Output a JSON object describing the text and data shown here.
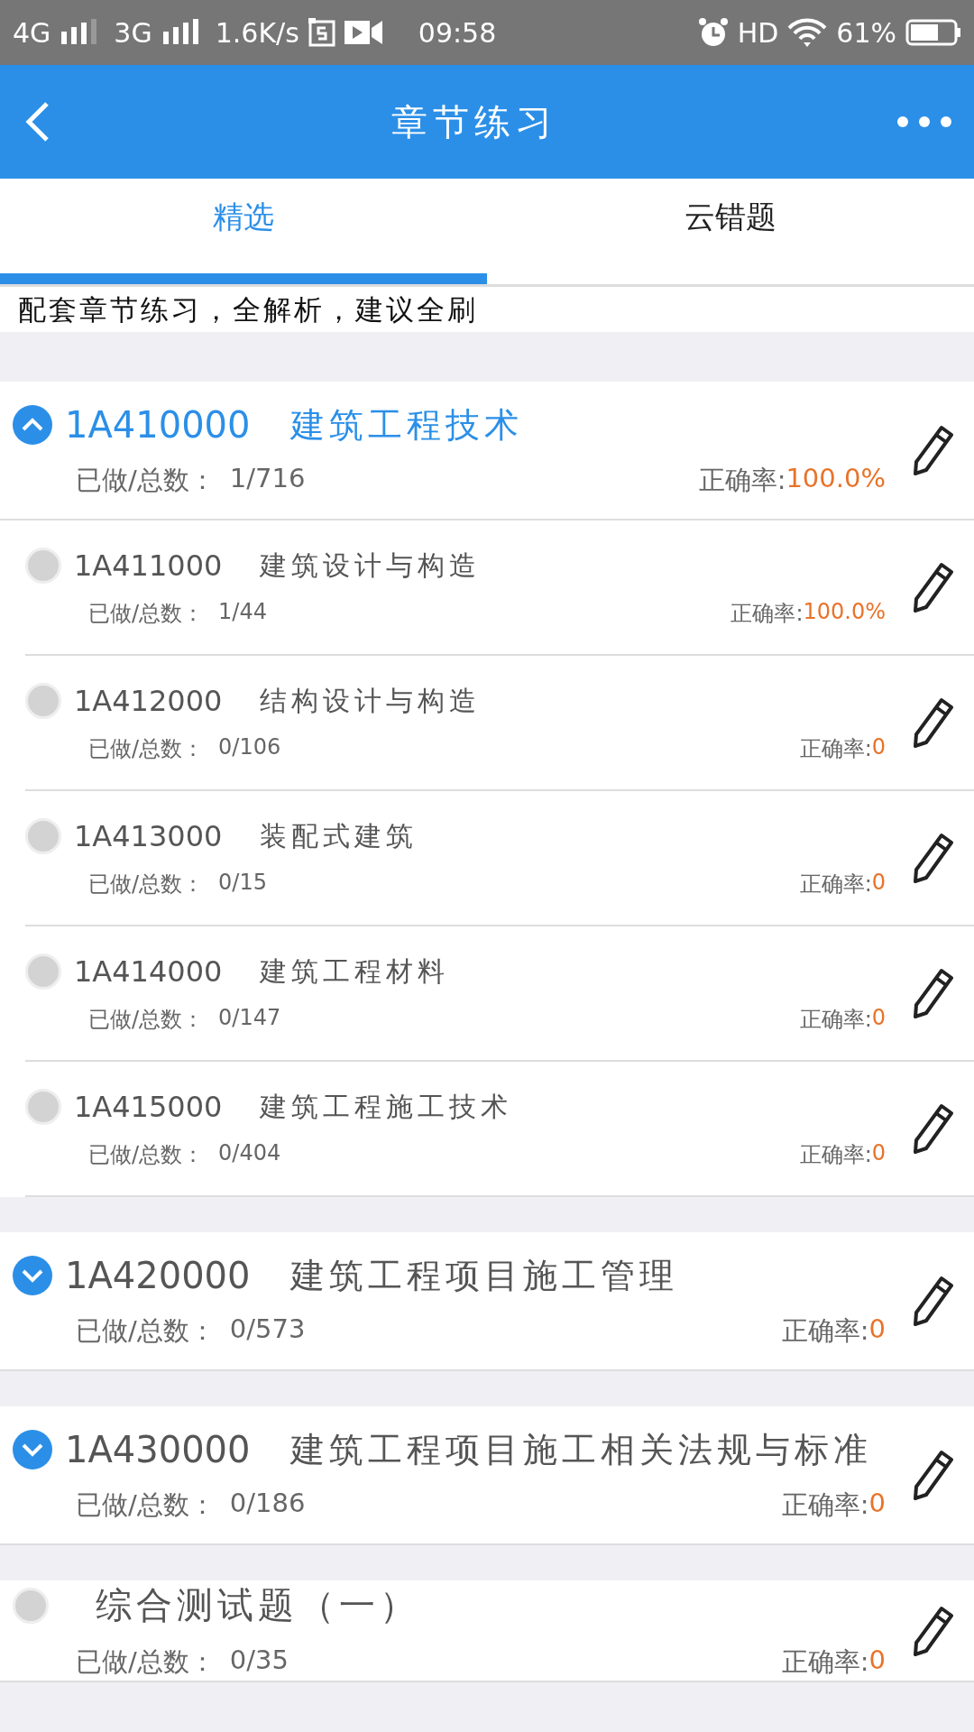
{
  "status_bar": {
    "network_1": "4G",
    "network_2": "3G",
    "speed": "1.6K/s",
    "time": "09:58",
    "hd": "HD",
    "battery": "61%"
  },
  "header": {
    "title": "章节练习"
  },
  "tabs": [
    {
      "label": "精选",
      "selected": true
    },
    {
      "label": "云错题",
      "selected": false
    }
  ],
  "description": "配套章节练习，全解析，建议全刷",
  "groups": [
    {
      "kind": "chapter",
      "code": "1A410000",
      "title": "建筑工程技术",
      "expanded": true,
      "done_label": "已做/总数：",
      "done": "1/716",
      "accuracy_label": "正确率:",
      "accuracy": "100.0%",
      "children": [
        {
          "selected": false,
          "code": "1A411000",
          "title": "建筑设计与构造",
          "done_label": "已做/总数：",
          "done": "1/44",
          "accuracy_label": "正确率:",
          "accuracy": "100.0%"
        },
        {
          "selected": false,
          "code": "1A412000",
          "title": "结构设计与构造",
          "done_label": "已做/总数：",
          "done": "0/106",
          "accuracy_label": "正确率:",
          "accuracy": "0"
        },
        {
          "selected": false,
          "code": "1A413000",
          "title": "装配式建筑",
          "done_label": "已做/总数：",
          "done": "0/15",
          "accuracy_label": "正确率:",
          "accuracy": "0"
        },
        {
          "selected": false,
          "code": "1A414000",
          "title": "建筑工程材料",
          "done_label": "已做/总数：",
          "done": "0/147",
          "accuracy_label": "正确率:",
          "accuracy": "0"
        },
        {
          "selected": false,
          "code": "1A415000",
          "title": "建筑工程施工技术",
          "done_label": "已做/总数：",
          "done": "0/404",
          "accuracy_label": "正确率:",
          "accuracy": "0"
        }
      ]
    },
    {
      "kind": "chapter",
      "code": "1A420000",
      "title": "建筑工程项目施工管理",
      "expanded": false,
      "done_label": "已做/总数：",
      "done": "0/573",
      "accuracy_label": "正确率:",
      "accuracy": "0"
    },
    {
      "kind": "chapter",
      "code": "1A430000",
      "title": "建筑工程项目施工相关法规与标准",
      "expanded": false,
      "done_label": "已做/总数：",
      "done": "0/186",
      "accuracy_label": "正确率:",
      "accuracy": "0"
    },
    {
      "kind": "test",
      "selected": false,
      "title": "综合测试题（一）",
      "done_label": "已做/总数：",
      "done": "0/35",
      "accuracy_label": "正确率:",
      "accuracy": "0"
    }
  ]
}
